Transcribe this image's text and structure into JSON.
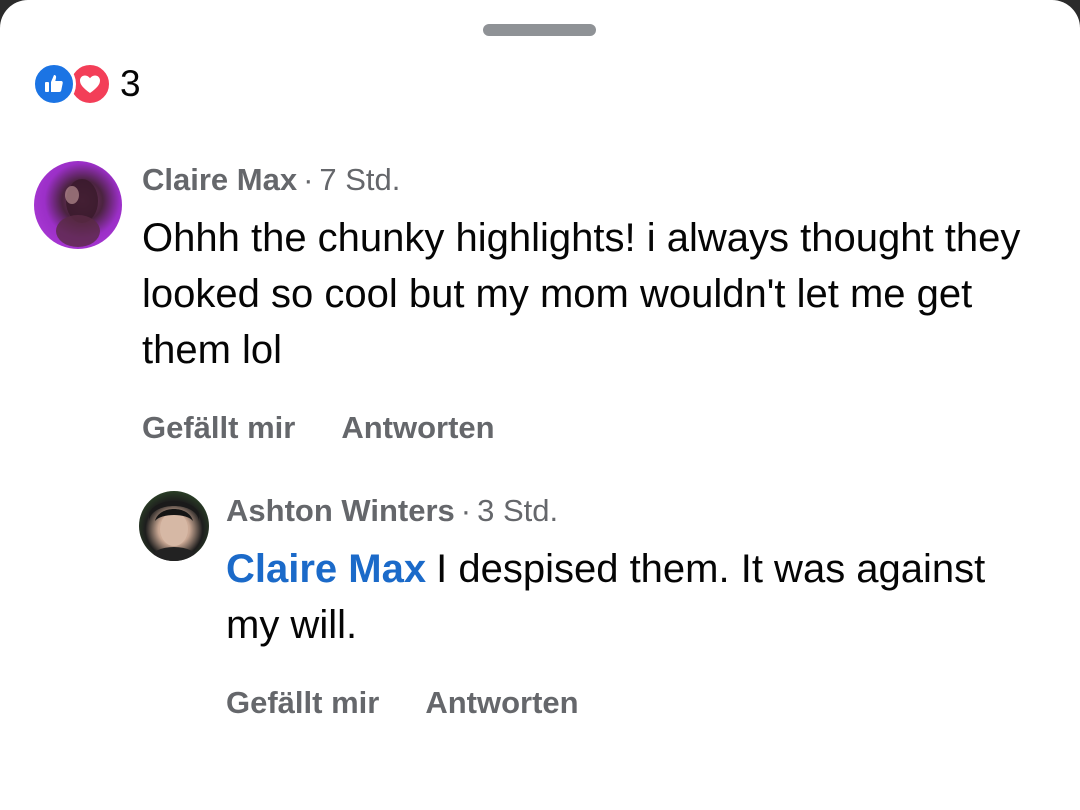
{
  "reactions": {
    "icons": [
      "like-icon",
      "love-icon"
    ],
    "count": "3",
    "colors": {
      "like": "#1b74e4",
      "love": "#f33e58"
    }
  },
  "comments": [
    {
      "author": "Claire Max",
      "separator": "·",
      "time": "7 Std.",
      "text": "Ohhh the chunky highlights! i always thought they looked so cool but my mom wouldn't let me get them lol",
      "actions": {
        "like": "Gefällt mir",
        "reply": "Antworten"
      }
    },
    {
      "author": "Ashton Winters",
      "separator": "·",
      "time": "3 Std.",
      "mention": "Claire Max",
      "text": "I despised them. It was against my will.",
      "actions": {
        "like": "Gefällt mir",
        "reply": "Antworten"
      }
    }
  ],
  "colors": {
    "mention": "#1b6ac9",
    "secondary_text": "#65676b",
    "primary_text": "#050505"
  }
}
